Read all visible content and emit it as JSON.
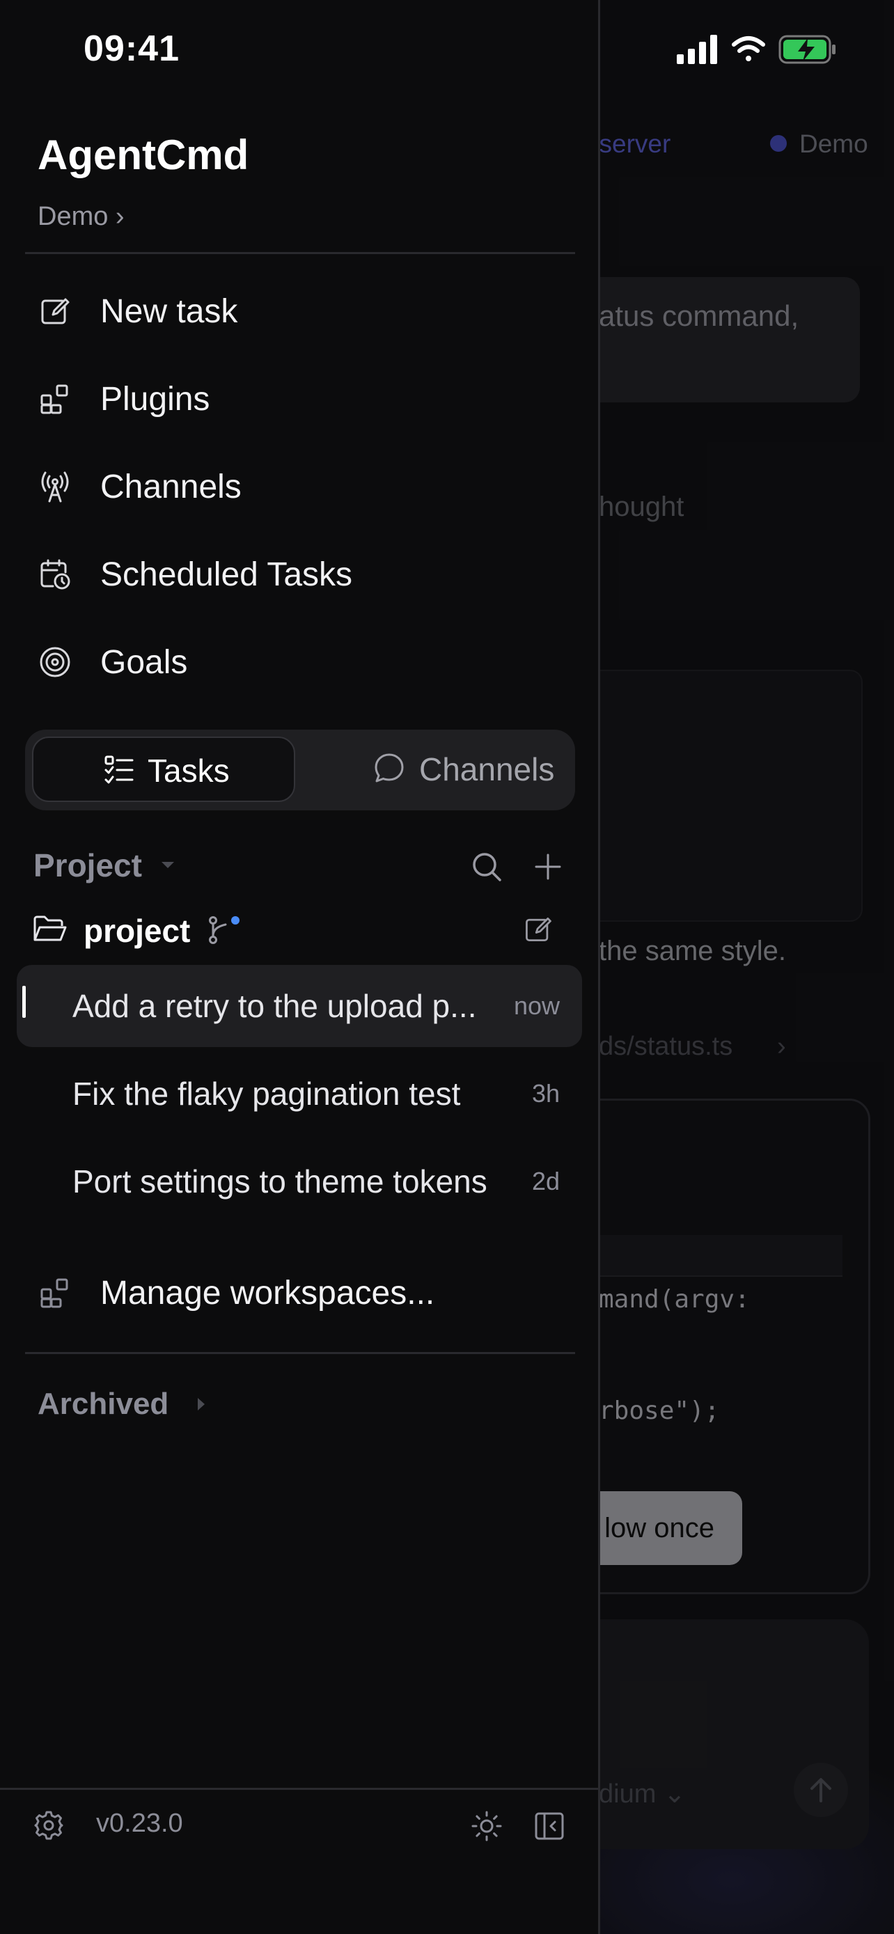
{
  "status_bar": {
    "time": "09:41"
  },
  "background": {
    "server_link": "ect a server",
    "server_name": "Demo",
    "message_fragment": "atus command,",
    "thought_fragment": "hought",
    "same_style_fragment": "the same style.",
    "file_fragment": "ds/status.ts",
    "code_line1": "mand(argv:",
    "code_line2": "rbose\");",
    "allow_button": "low once",
    "model_fragment": "dium"
  },
  "drawer": {
    "app_title": "AgentCmd",
    "workspace_link": "Demo ›",
    "nav": [
      {
        "label": "New task",
        "icon": "compose-icon"
      },
      {
        "label": "Plugins",
        "icon": "plugins-icon"
      },
      {
        "label": "Channels",
        "icon": "broadcast-icon"
      },
      {
        "label": "Scheduled Tasks",
        "icon": "calendar-clock-icon"
      },
      {
        "label": "Goals",
        "icon": "target-icon"
      }
    ],
    "segments": {
      "tasks": "Tasks",
      "channels": "Channels",
      "selected": "Tasks"
    },
    "section": {
      "title": "Project"
    },
    "folder": {
      "name": "project"
    },
    "tasks": [
      {
        "title": "Add a retry to the upload p...",
        "time": "now",
        "selected": true
      },
      {
        "title": "Fix the flaky pagination test",
        "time": "3h",
        "selected": false
      },
      {
        "title": "Port settings to theme tokens",
        "time": "2d",
        "selected": false
      }
    ],
    "manage_workspaces": "Manage workspaces...",
    "archived": "Archived",
    "footer": {
      "version": "v0.23.0"
    }
  }
}
